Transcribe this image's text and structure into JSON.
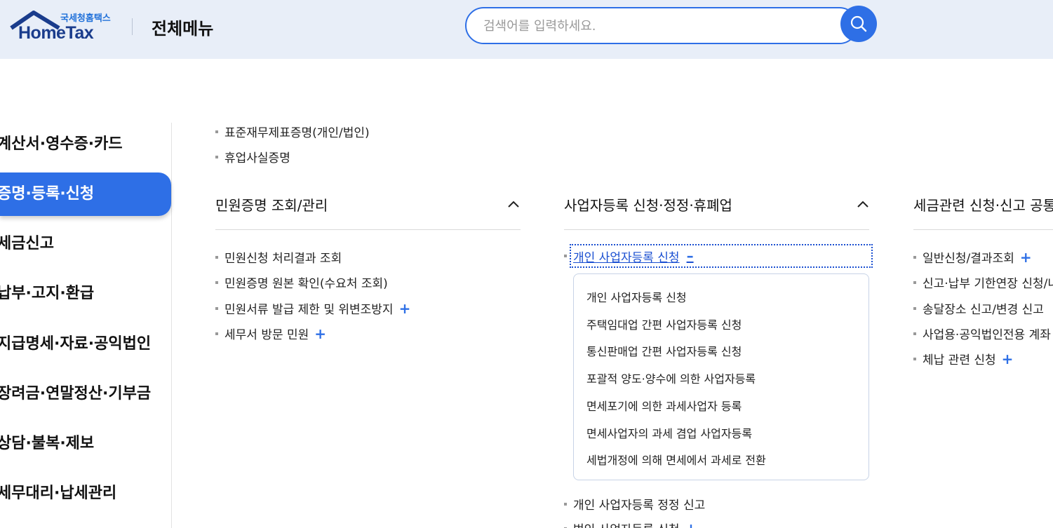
{
  "header": {
    "logo_sub": "국세청홈택스",
    "logo_main": "HomeTax",
    "page_title": "전체메뉴",
    "search_placeholder": "검색어를 입력하세요.",
    "brand_color": "#2e6fe6",
    "header_bg": "#e8eef8"
  },
  "left_nav": {
    "items": [
      {
        "label": "계산서·영수증·카드",
        "active": false
      },
      {
        "label": "증명·등록·신청",
        "active": true
      },
      {
        "label": "세금신고",
        "active": false
      },
      {
        "label": "납부·고지·환급",
        "active": false
      },
      {
        "label": "지급명세·자료·공익법인",
        "active": false
      },
      {
        "label": "장려금·연말정산·기부금",
        "active": false
      },
      {
        "label": "상담·불복·제보",
        "active": false
      },
      {
        "label": "세무대리·납세관리",
        "active": false
      }
    ]
  },
  "col1": {
    "top_links": [
      "표준재무제표증명(개인/법인)",
      "휴업사실증명"
    ],
    "heading": "민원증명 조회/관리",
    "links": [
      {
        "label": "민원신청 처리결과 조회",
        "plus": ""
      },
      {
        "label": "민원증명 원본 확인(수요처 조회)",
        "plus": ""
      },
      {
        "label": "민원서류 발급 제한 및 위변조방지",
        "plus": "+"
      },
      {
        "label": "세무서 방문 민원",
        "plus": "+"
      }
    ]
  },
  "col2": {
    "heading": "사업자등록 신청·정정·휴폐업",
    "expanded_link": "개인 사업자등록 신청",
    "expanded_sign": "–",
    "sub_items": [
      "개인 사업자등록 신청",
      "주택임대업 간편 사업자등록 신청",
      "통신판매업 간편 사업자등록 신청",
      "포괄적 양도·양수에 의한 사업자등록",
      "면세포기에 의한 과세사업자 등록",
      "면세사업자의 과세 겸업 사업자등록",
      "세법개정에 의해 면세에서 과세로 전환"
    ],
    "after_links": [
      {
        "label": "개인 사업자등록 정정 신고",
        "plus": ""
      },
      {
        "label": "법인 사업자등록 신청",
        "plus": "+"
      }
    ]
  },
  "col3": {
    "heading": "세금관련 신청·신고 공통",
    "links": [
      {
        "label": "일반신청/결과조회",
        "plus": "+"
      },
      {
        "label": "신고·납부 기한연장 신청/내역조회",
        "plus": ""
      },
      {
        "label": "송달장소 신고/변경 신고",
        "plus": ""
      },
      {
        "label": "사업용·공익법인전용 계좌 신고",
        "plus": ""
      },
      {
        "label": "체납 관련 신청",
        "plus": "+"
      }
    ]
  }
}
